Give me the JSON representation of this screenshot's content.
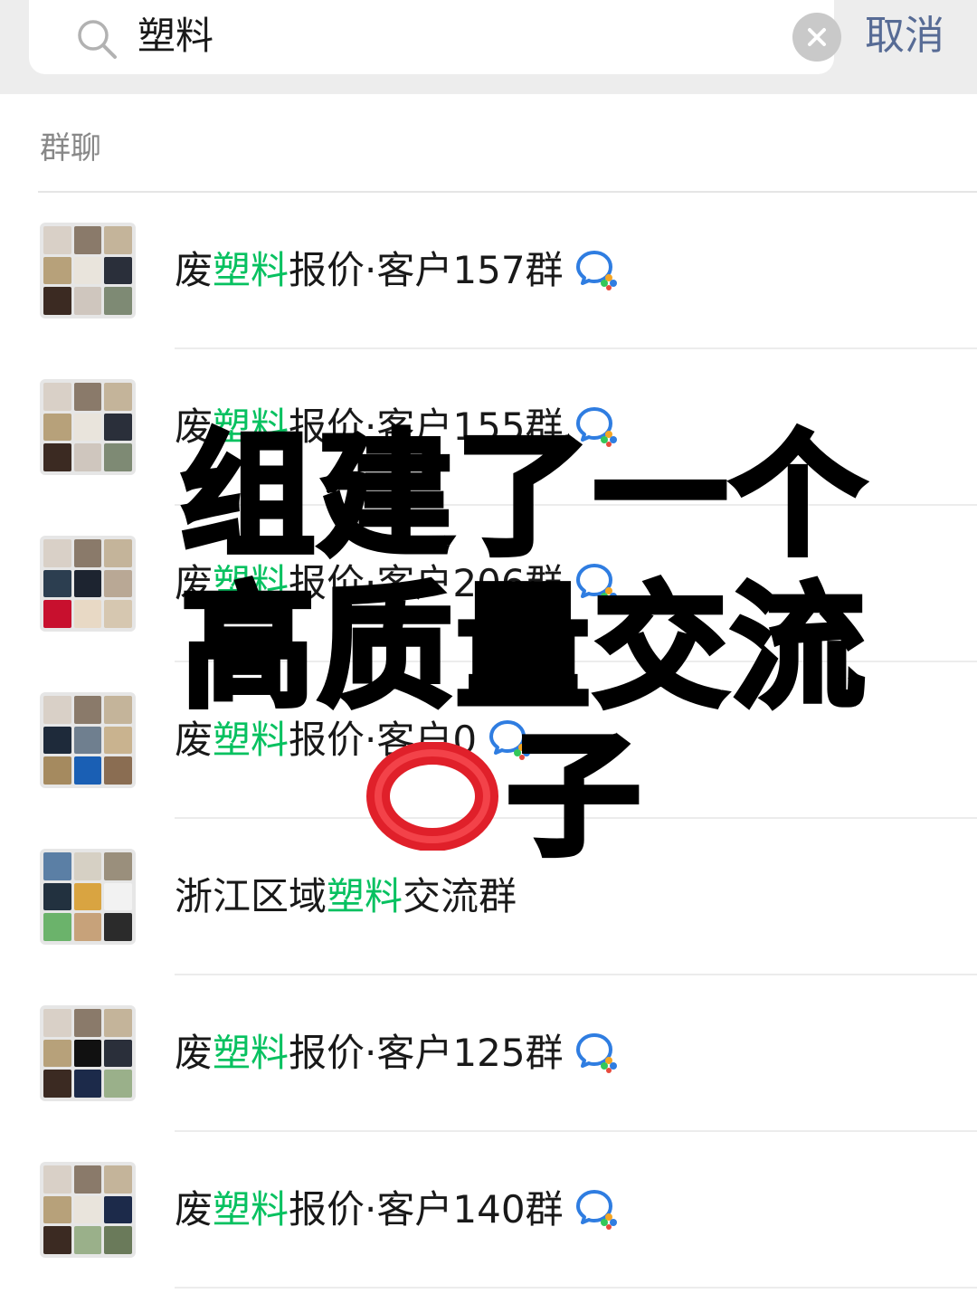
{
  "search": {
    "query": "塑料",
    "cancel_label": "取消"
  },
  "section": {
    "title": "群聊"
  },
  "results": [
    {
      "prefix": "废",
      "highlight": "塑料",
      "suffix": "报价·客户157群",
      "has_wecom_icon": true
    },
    {
      "prefix": "废",
      "highlight": "塑料",
      "suffix": "报价·客户155群",
      "has_wecom_icon": true
    },
    {
      "prefix": "废",
      "highlight": "塑料",
      "suffix": "报价·客户206群",
      "has_wecom_icon": true
    },
    {
      "prefix": "废",
      "highlight": "塑料",
      "suffix": "报价·客户0",
      "has_wecom_icon": true
    },
    {
      "prefix": "浙江区域",
      "highlight": "塑料",
      "suffix": "交流群",
      "has_wecom_icon": false
    },
    {
      "prefix": "废",
      "highlight": "塑料",
      "suffix": "报价·客户125群",
      "has_wecom_icon": true
    },
    {
      "prefix": "废",
      "highlight": "塑料",
      "suffix": "报价·客户140群",
      "has_wecom_icon": true
    }
  ],
  "overlay": {
    "line1": "组建了一个",
    "line2": "高质量交流",
    "line3": "子",
    "ring_icon": "heavy-large-circle-icon"
  },
  "colors": {
    "highlight": "#07c160",
    "cancel": "#576b95",
    "ring": "#e0202a"
  }
}
